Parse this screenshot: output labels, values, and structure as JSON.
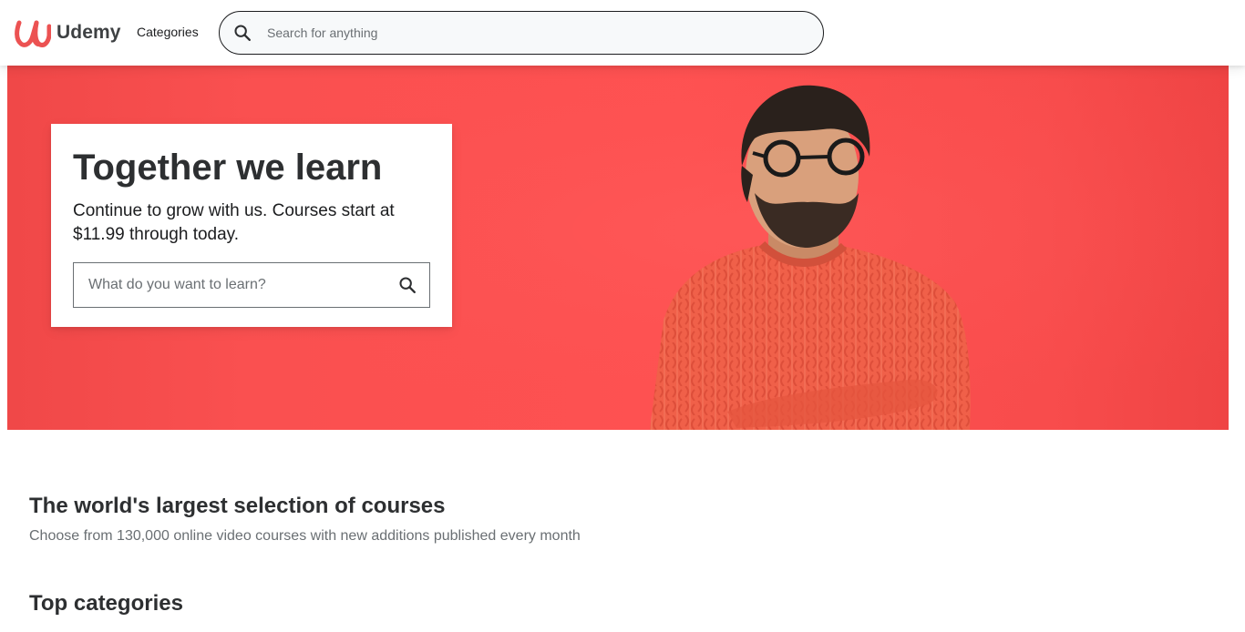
{
  "brand": {
    "name": "Udemy",
    "accent_color": "#a435f0",
    "logo_color": "#ec5252"
  },
  "nav": {
    "categories_label": "Categories",
    "search_placeholder": "Search for anything",
    "search_icon": "search-icon"
  },
  "hero": {
    "title": "Together we learn",
    "subtitle": "Continue to grow with us. Courses start at $11.99 through today.",
    "search_placeholder": "What do you want to learn?",
    "background_color": "#fe5151"
  },
  "main": {
    "selection_title": "The world's largest selection of courses",
    "selection_subtitle": "Choose from 130,000 online video courses with new additions published every month",
    "top_categories_title": "Top categories"
  }
}
